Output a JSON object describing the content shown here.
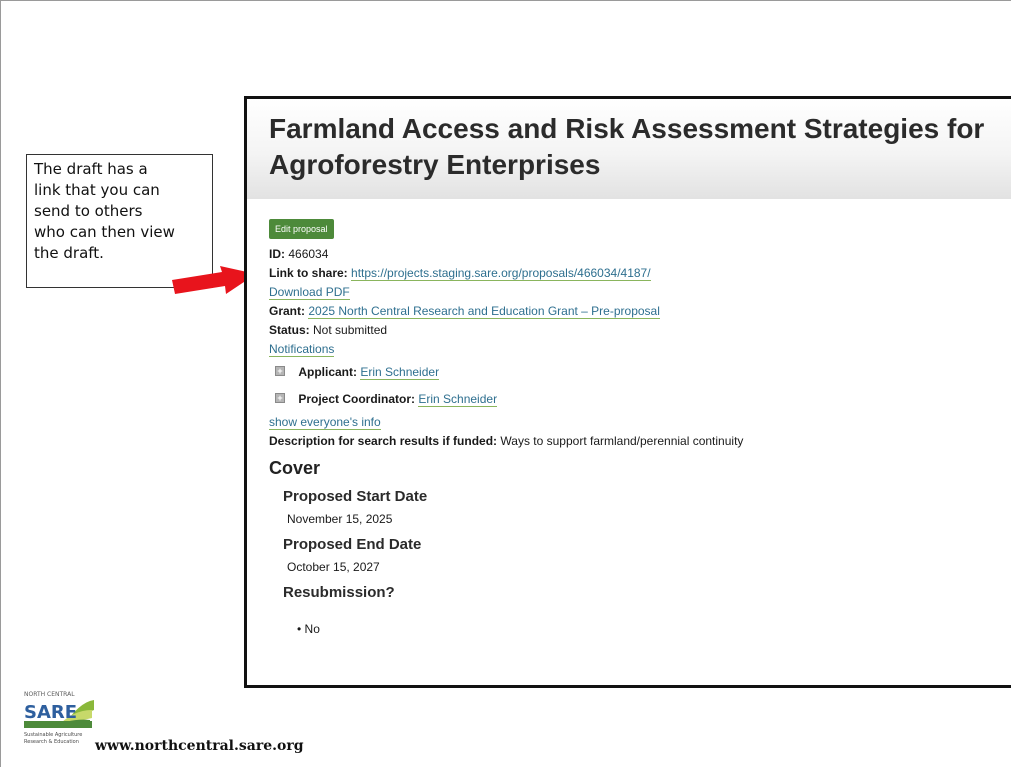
{
  "callout": {
    "text_lines": [
      "The draft has a",
      "link that you can",
      "send to others",
      "who can then view",
      "the draft."
    ]
  },
  "proposal": {
    "title_line1": "Farmland Access and Risk Assessment Strategies for",
    "title_line2": "Agroforestry Enterprises",
    "edit_button": "Edit proposal",
    "id_label": "ID:",
    "id_value": "466034",
    "link_label": "Link to share:",
    "link_value": "https://projects.staging.sare.org/proposals/466034/4187/",
    "download_pdf": "Download PDF",
    "grant_label": "Grant:",
    "grant_value": "2025 North Central Research and Education Grant – Pre-proposal",
    "status_label": "Status:",
    "status_value": "Not submitted",
    "notifications": "Notifications",
    "applicant_label": "Applicant:",
    "applicant_value": "Erin Schneider",
    "coordinator_label": "Project Coordinator:",
    "coordinator_value": "Erin Schneider",
    "show_everyone": "show everyone's info",
    "description_label": "Description for search results if funded:",
    "description_value": "Ways to support farmland/perennial continuity",
    "cover_heading": "Cover",
    "start_label": "Proposed Start Date",
    "start_value": "November 15, 2025",
    "end_label": "Proposed End Date",
    "end_value": "October 15, 2027",
    "resubmission_label": "Resubmission?",
    "resubmission_value": "No"
  },
  "footer": {
    "logo_top": "NORTH CENTRAL",
    "logo_main": "SARE",
    "logo_sub1": "Sustainable Agriculture",
    "logo_sub2": "Research & Education",
    "url": "www.northcentral.sare.org"
  },
  "colors": {
    "button_green": "#4d8a3a",
    "link_blue": "#2e6f8f",
    "arrow_red": "#e8141c"
  }
}
